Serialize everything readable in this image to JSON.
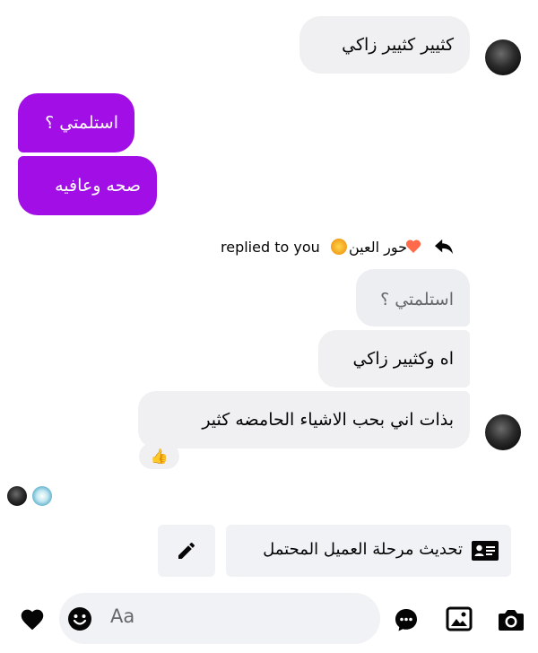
{
  "colors": {
    "outgoing_bubble": "#a10fe6",
    "incoming_bubble": "#f0f0f2",
    "reply_bubble": "#eceef1",
    "text_primary": "#050505",
    "text_secondary": "#65676b",
    "icon": "#050505"
  },
  "messages": [
    {
      "from": "contact",
      "text": "كثيير كثيير زاكي"
    },
    {
      "from": "me",
      "text": "استلمتي ؟"
    },
    {
      "from": "me",
      "text": "صحه وعافيه"
    }
  ],
  "reply": {
    "header": "replied to you",
    "sender_name": "حور العين",
    "quoted_text": "استلمتي ؟",
    "messages": [
      {
        "text": "اه وكثيير زاكي"
      },
      {
        "text": "بذات اني بحب الاشياء الحامضه كثير"
      }
    ],
    "reaction": "👍"
  },
  "actions": {
    "update_stage_label": "تحديث مرحلة العميل المحتمل",
    "edit_icon": "pencil-icon",
    "contact_card_icon": "contact-card-icon"
  },
  "composer": {
    "placeholder": "Aa",
    "icons": [
      "heart-icon",
      "emoji-icon",
      "chat-bubble-icon",
      "gallery-icon",
      "camera-icon"
    ]
  }
}
